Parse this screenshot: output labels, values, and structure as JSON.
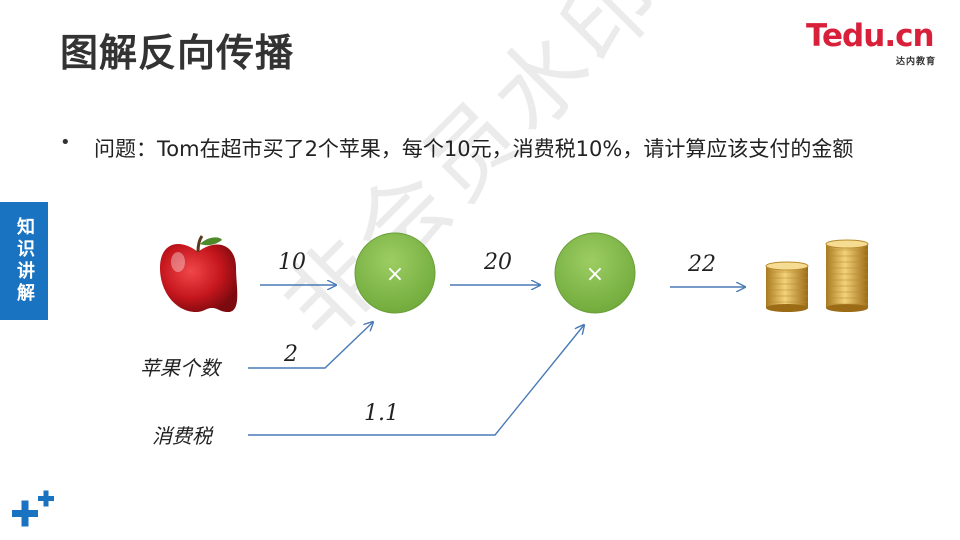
{
  "slide": {
    "title": "图解反向传播",
    "bullet": "问题：Tom在超市买了2个苹果，每个10元，消费税10%，请计算应该支付的金额",
    "side_tab": "知识讲解",
    "watermark": "非会员水印"
  },
  "logo": {
    "main": "Tedu.cn",
    "sub": "达内教育"
  },
  "diagram": {
    "nodes": [
      {
        "symbol": "×"
      },
      {
        "symbol": "×"
      }
    ],
    "edge_values": {
      "apple_price": "10",
      "after_first": "20",
      "result": "22",
      "count": "2",
      "tax": "1.1"
    },
    "input_labels": {
      "count": "苹果个数",
      "tax": "消费税"
    }
  },
  "icons": {
    "apple": "apple-icon",
    "coins": "coin-stacks-icon",
    "plus": "plus-decoration-icon"
  },
  "colors": {
    "node_green": "#7ab648",
    "arrow_blue": "#4a7ab5",
    "tab_blue": "#1a73c0",
    "logo_red": "#d8203a"
  }
}
